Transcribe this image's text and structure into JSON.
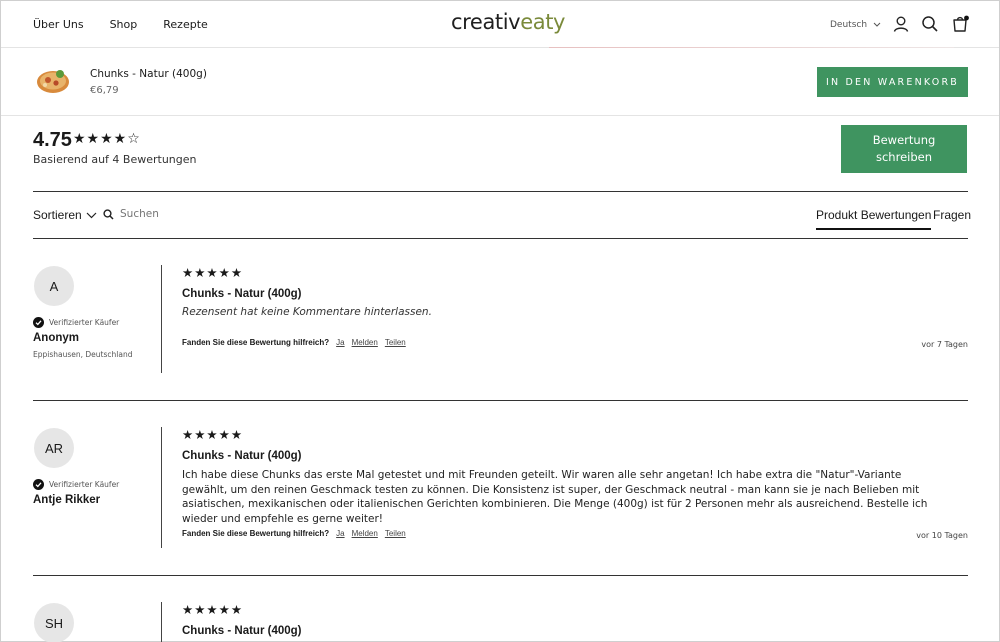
{
  "header": {
    "nav": [
      "Über Uns",
      "Shop",
      "Rezepte"
    ],
    "logo": {
      "part1": "creativ",
      "part2": "eaty"
    },
    "language": "Deutsch",
    "accent_color": "#3f9460"
  },
  "sticky_bar": {
    "product_name": "Chunks - Natur (400g)",
    "price": "€6,79",
    "cart_button": "IN DEN WARENKORB"
  },
  "summary": {
    "average": "4.75",
    "stars": "★★★★☆",
    "based_on": "Basierend auf 4 Bewertungen",
    "write_button": "Bewertung schreiben"
  },
  "toolbar": {
    "sort_label": "Sortieren",
    "search_placeholder": "Suchen",
    "tab_reviews": "Produkt Bewertungen",
    "tab_questions": "Fragen"
  },
  "reviews": [
    {
      "initials": "A",
      "verified": "Verifizierter Käufer",
      "name": "Anonym",
      "location": "Eppishausen, Deutschland",
      "stars": "★★★★★",
      "title": "Chunks - Natur (400g)",
      "body": "Rezensent hat keine Kommentare hinterlassen.",
      "helpful_q": "Fanden Sie diese Bewertung hilfreich?",
      "yes": "Ja",
      "report": "Melden",
      "share": "Teilen",
      "date": "vor 7 Tagen"
    },
    {
      "initials": "AR",
      "verified": "Verifizierter Käufer",
      "name": "Antje Rikker",
      "location": "",
      "stars": "★★★★★",
      "title": "Chunks - Natur (400g)",
      "body": "Ich habe diese Chunks das erste Mal getestet und mit Freunden geteilt. Wir waren alle sehr angetan! Ich habe extra die \"Natur\"-Variante gewählt, um den reinen Geschmack testen zu können. Die Konsistenz ist super, der Geschmack neutral - man kann sie je nach Belieben mit asiatischen, mexikanischen oder italienischen Gerichten kombinieren. Die Menge (400g) ist für 2 Personen mehr als ausreichend. Bestelle ich wieder und empfehle es gerne weiter!",
      "helpful_q": "Fanden Sie diese Bewertung hilfreich?",
      "yes": "Ja",
      "report": "Melden",
      "share": "Teilen",
      "date": "vor 10 Tagen"
    },
    {
      "initials": "SH",
      "stars": "★★★★★",
      "title": "Chunks - Natur (400g)"
    }
  ]
}
